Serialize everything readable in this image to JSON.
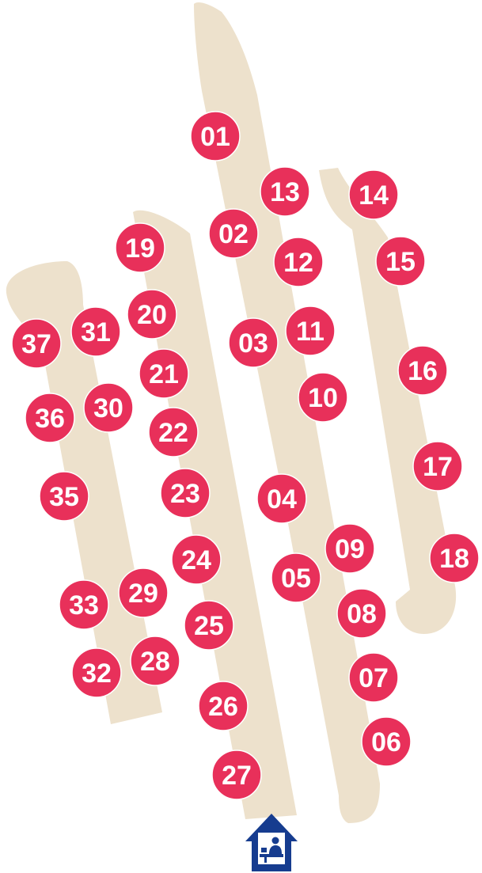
{
  "map": {
    "colors": {
      "path": "#ede1cc",
      "spot": "#e8305a",
      "spot_text": "#ffffff",
      "entrance": "#163c8f",
      "background": "#ffffff"
    },
    "spots": [
      {
        "label": "01"
      },
      {
        "label": "02"
      },
      {
        "label": "03"
      },
      {
        "label": "04"
      },
      {
        "label": "05"
      },
      {
        "label": "06"
      },
      {
        "label": "07"
      },
      {
        "label": "08"
      },
      {
        "label": "09"
      },
      {
        "label": "10"
      },
      {
        "label": "11"
      },
      {
        "label": "12"
      },
      {
        "label": "13"
      },
      {
        "label": "14"
      },
      {
        "label": "15"
      },
      {
        "label": "16"
      },
      {
        "label": "17"
      },
      {
        "label": "18"
      },
      {
        "label": "19"
      },
      {
        "label": "20"
      },
      {
        "label": "21"
      },
      {
        "label": "22"
      },
      {
        "label": "23"
      },
      {
        "label": "24"
      },
      {
        "label": "25"
      },
      {
        "label": "26"
      },
      {
        "label": "27"
      },
      {
        "label": "28"
      },
      {
        "label": "29"
      },
      {
        "label": "30"
      },
      {
        "label": "31"
      },
      {
        "label": "32"
      },
      {
        "label": "33"
      },
      {
        "label": "35"
      },
      {
        "label": "36"
      },
      {
        "label": "37"
      }
    ],
    "entrance": {
      "icon": "reception-booth-icon"
    }
  }
}
